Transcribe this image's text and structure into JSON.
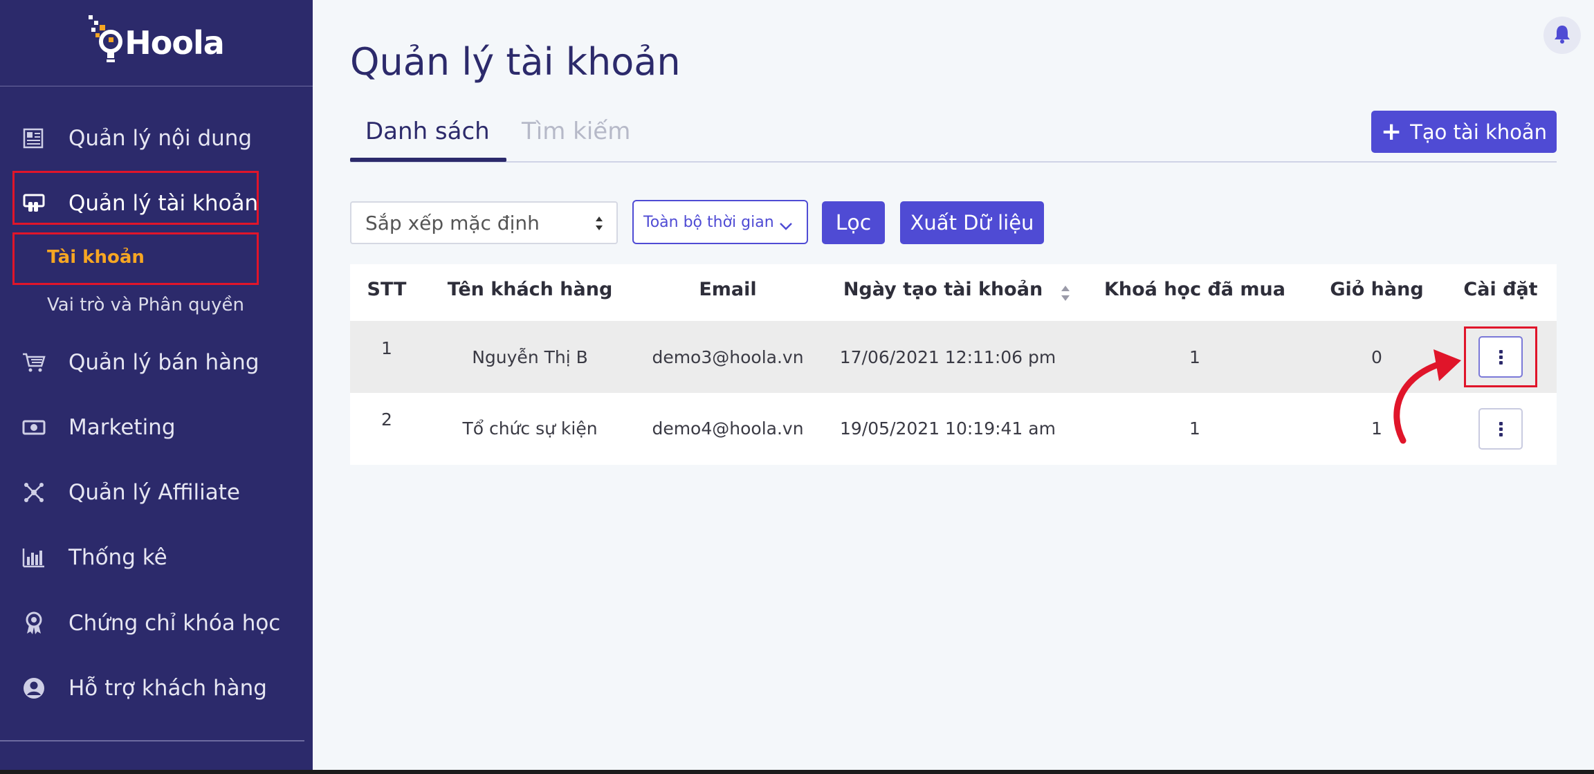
{
  "app": {
    "brand": "Hoola"
  },
  "sidebar": {
    "items": [
      {
        "label": "Quản lý nội dung",
        "icon": "newspaper-icon"
      },
      {
        "label": "Quản lý tài khoản",
        "icon": "account-icon"
      },
      {
        "label": "Quản lý bán hàng",
        "icon": "cart-icon"
      },
      {
        "label": "Marketing",
        "icon": "money-icon"
      },
      {
        "label": "Quản lý Affiliate",
        "icon": "affiliate-icon"
      },
      {
        "label": "Thống kê",
        "icon": "chart-icon"
      },
      {
        "label": "Chứng chỉ khóa học",
        "icon": "certificate-icon"
      },
      {
        "label": "Hỗ trợ khách hàng",
        "icon": "support-icon"
      }
    ],
    "sub_items": [
      {
        "label": "Tài khoản"
      },
      {
        "label": "Vai trò và Phân quyền"
      }
    ]
  },
  "page": {
    "title": "Quản lý tài khoản"
  },
  "tabs": [
    {
      "label": "Danh sách"
    },
    {
      "label": "Tìm kiếm"
    }
  ],
  "actions": {
    "create_label": "Tạo tài khoản",
    "sort_value": "Sắp xếp mặc định",
    "time_value": "Toàn bộ thời gian",
    "filter_label": "Lọc",
    "export_label": "Xuất Dữ liệu"
  },
  "table": {
    "headers": [
      "STT",
      "Tên khách hàng",
      "Email",
      "Ngày tạo tài khoản",
      "Khoá học đã mua",
      "Giỏ hàng",
      "Cài đặt"
    ],
    "rows": [
      {
        "stt": "1",
        "name": "Nguyễn Thị B",
        "email": "demo3@hoola.vn",
        "created": "17/06/2021 12:11:06 pm",
        "courses": "1",
        "cart": "0"
      },
      {
        "stt": "2",
        "name": "Tổ chức sự kiện",
        "email": "demo4@hoola.vn",
        "created": "19/05/2021 10:19:41 am",
        "courses": "1",
        "cart": "1"
      }
    ]
  },
  "colors": {
    "sidebar_bg": "#2c2a6b",
    "accent": "#4f4bd4",
    "active_sub": "#f6a623",
    "highlight": "#e0152a"
  }
}
